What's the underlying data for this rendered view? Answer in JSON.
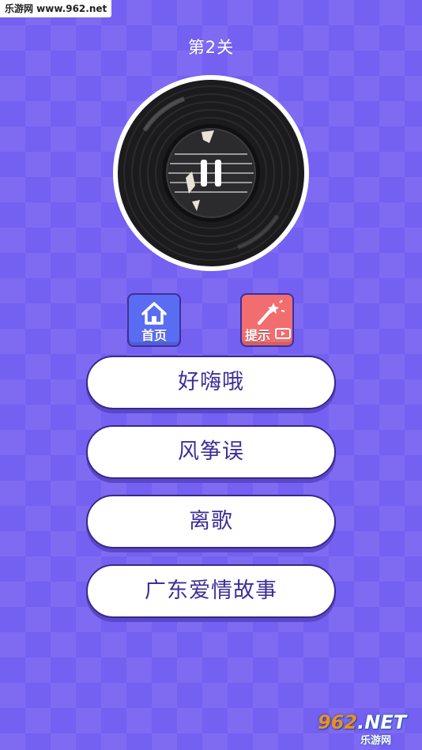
{
  "watermark": {
    "top_left": "乐游网 www.962.net",
    "logo_number": "962",
    "logo_suffix": ".NET",
    "logo_sub": "乐游网"
  },
  "level": {
    "title": "第2关"
  },
  "player": {
    "state": "playing",
    "control_icon": "pause-icon"
  },
  "buttons": {
    "home_label": "首页",
    "hint_label": "提示",
    "home_icon": "home-icon",
    "hint_icon": "magic-wand-icon",
    "video_icon": "video-icon"
  },
  "answers": [
    {
      "label": "好嗨哦"
    },
    {
      "label": "风筝误"
    },
    {
      "label": "离歌"
    },
    {
      "label": "广东爱情故事"
    }
  ],
  "colors": {
    "background": "#7460f1",
    "home_button": "#5a6cf2",
    "hint_button": "#f26d6f",
    "answer_text": "#3e2f98"
  }
}
